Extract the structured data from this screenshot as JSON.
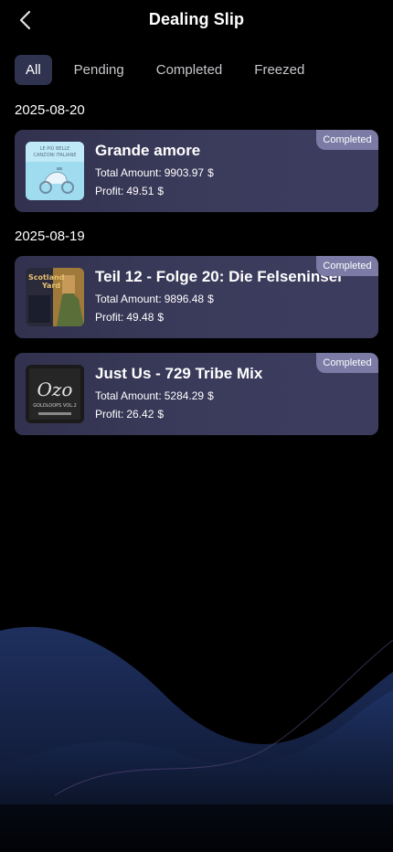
{
  "header": {
    "title": "Dealing Slip"
  },
  "tabs": [
    {
      "label": "All",
      "active": true
    },
    {
      "label": "Pending",
      "active": false
    },
    {
      "label": "Completed",
      "active": false
    },
    {
      "label": "Freezed",
      "active": false
    }
  ],
  "groups": [
    {
      "date": "2025-08-20",
      "items": [
        {
          "title": "Grande amore",
          "status": "Completed",
          "amount_label": "Total Amount:",
          "amount": "9903.97",
          "profit_label": "Profit:",
          "profit": "49.51",
          "currency": "$",
          "cover_text": "LE PIÙ BELLE CANZONI ITALIANE"
        }
      ]
    },
    {
      "date": "2025-08-19",
      "items": [
        {
          "title": "Teil 12 - Folge 20: Die Felseninsel",
          "status": "Completed",
          "amount_label": "Total Amount:",
          "amount": "9896.48",
          "profit_label": "Profit:",
          "profit": "49.48",
          "currency": "$",
          "cover_text": "Scotland Yard"
        },
        {
          "title": "Just Us - 729 Tribe Mix",
          "status": "Completed",
          "amount_label": "Total Amount:",
          "amount": "5284.29",
          "profit_label": "Profit:",
          "profit": "26.42",
          "currency": "$",
          "cover_text": "OZO"
        }
      ]
    }
  ],
  "colors": {
    "background": "#000000",
    "card": "#36365a",
    "badge": "#7b7ba6",
    "tab_active": "#2f3350",
    "wave": "#1c2d5c"
  }
}
